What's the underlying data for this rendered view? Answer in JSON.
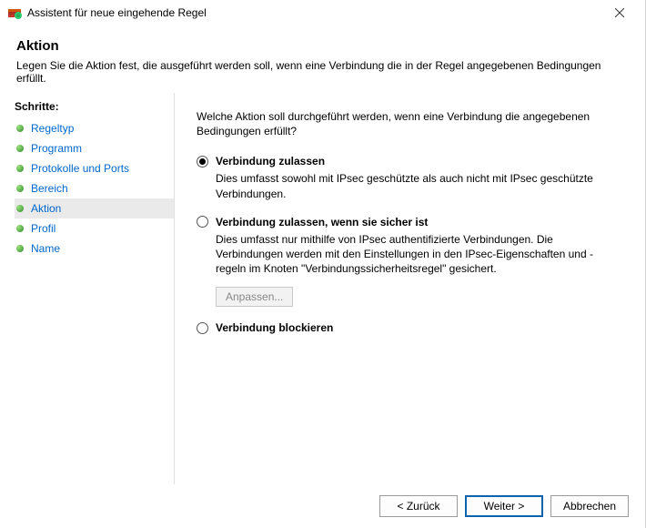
{
  "window": {
    "title": "Assistent für neue eingehende Regel"
  },
  "header": {
    "title": "Aktion",
    "subtitle": "Legen Sie die Aktion fest, die ausgeführt werden soll, wenn eine Verbindung die in der Regel angegebenen Bedingungen erfüllt."
  },
  "sidebar": {
    "title": "Schritte:",
    "items": [
      {
        "label": "Regeltyp"
      },
      {
        "label": "Programm"
      },
      {
        "label": "Protokolle und Ports"
      },
      {
        "label": "Bereich"
      },
      {
        "label": "Aktion"
      },
      {
        "label": "Profil"
      },
      {
        "label": "Name"
      }
    ]
  },
  "main": {
    "question": "Welche Aktion soll durchgeführt werden, wenn eine Verbindung die angegebenen Bedingungen erfüllt?",
    "options": [
      {
        "title": "Verbindung zulassen",
        "desc": "Dies umfasst sowohl mit IPsec geschützte als auch nicht mit IPsec geschützte Verbindungen."
      },
      {
        "title": "Verbindung zulassen, wenn sie sicher ist",
        "desc": "Dies umfasst nur mithilfe von IPsec authentifizierte Verbindungen. Die Verbindungen werden mit den Einstellungen in den IPsec-Eigenschaften und -regeln im Knoten \"Verbindungssicherheitsregel\" gesichert."
      },
      {
        "title": "Verbindung blockieren"
      }
    ],
    "customize_label": "Anpassen..."
  },
  "footer": {
    "back": "< Zurück",
    "next": "Weiter >",
    "cancel": "Abbrechen"
  }
}
